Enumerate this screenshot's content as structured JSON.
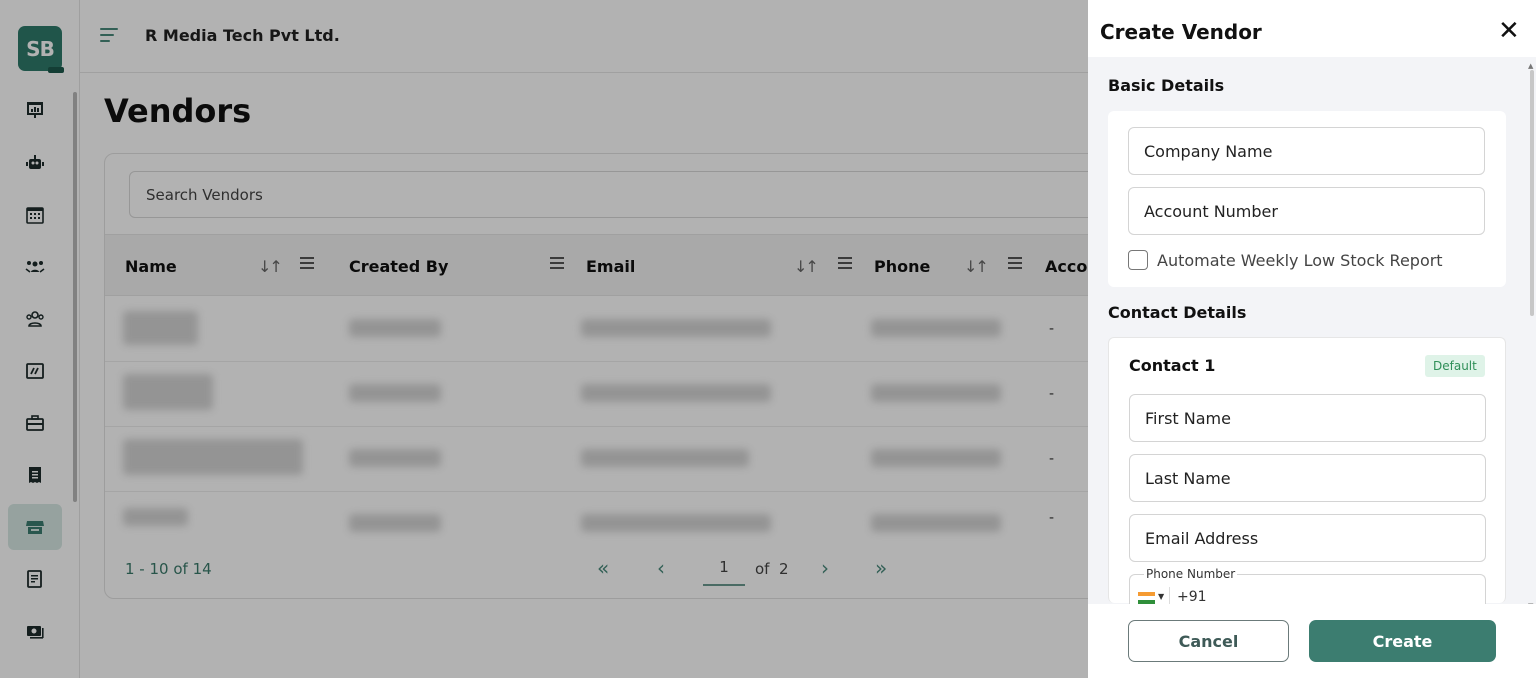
{
  "logo": {
    "text": "SB"
  },
  "header": {
    "company": "R Media Tech Pvt Ltd."
  },
  "page": {
    "title": "Vendors"
  },
  "sidebar": {
    "items": [
      {
        "icon": "presentation-chart-icon"
      },
      {
        "icon": "robot-icon"
      },
      {
        "icon": "calendar-icon"
      },
      {
        "icon": "team-meeting-icon"
      },
      {
        "icon": "users-group-icon"
      },
      {
        "icon": "activity-board-icon"
      },
      {
        "icon": "briefcase-icon"
      },
      {
        "icon": "receipt-icon"
      },
      {
        "icon": "store-icon",
        "active": true
      },
      {
        "icon": "invoice-icon"
      },
      {
        "icon": "cash-icon"
      }
    ]
  },
  "search": {
    "placeholder": "Search Vendors"
  },
  "table": {
    "columns": [
      "Name",
      "Created By",
      "Email",
      "Phone",
      "Account"
    ],
    "rows": [
      {
        "account": "-"
      },
      {
        "account": "-"
      },
      {
        "account": "-"
      },
      {
        "account": "-"
      }
    ]
  },
  "pagination": {
    "summary": "1 - 10 of 14",
    "page": "1",
    "of_text": "of",
    "total_pages": "2"
  },
  "panel": {
    "title": "Create Vendor",
    "close_glyph": "✕",
    "basic_details_title": "Basic Details",
    "company_name_placeholder": "Company Name",
    "account_number_placeholder": "Account Number",
    "automate_label": "Automate Weekly Low Stock Report",
    "contact_details_title": "Contact Details",
    "contact_title": "Contact 1",
    "default_badge": "Default",
    "first_name_placeholder": "First Name",
    "last_name_placeholder": "Last Name",
    "email_placeholder": "Email Address",
    "phone_label": "Phone Number",
    "phone_code": "+91",
    "cancel_label": "Cancel",
    "create_label": "Create"
  },
  "colors": {
    "accent": "#3c7d70",
    "badge_bg": "#dff3e8",
    "badge_text": "#2f8f58"
  }
}
